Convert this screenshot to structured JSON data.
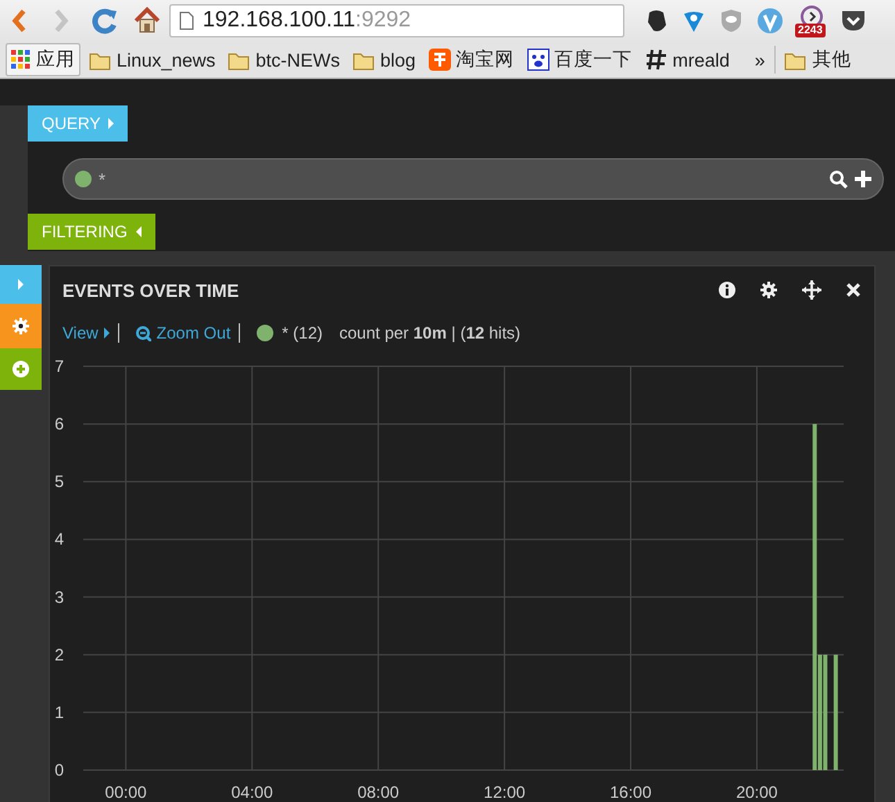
{
  "browser": {
    "address": {
      "host": "192.168.100.11",
      "port": ":9292"
    },
    "extension_badge": "2243",
    "bookmarks": [
      {
        "label": "应用",
        "kind": "apps"
      },
      {
        "label": "Linux_news",
        "kind": "folder"
      },
      {
        "label": "btc-NEWs",
        "kind": "folder"
      },
      {
        "label": "blog",
        "kind": "folder"
      },
      {
        "label": "淘宝网",
        "kind": "taobao"
      },
      {
        "label": "百度一下",
        "kind": "baidu"
      },
      {
        "label": "mreald",
        "kind": "hash"
      }
    ],
    "overflow": "»",
    "other_bookmarks": {
      "label": "其他",
      "kind": "folder"
    }
  },
  "query": {
    "label": "QUERY",
    "queries": [
      {
        "value": "*",
        "color": "#7eb26d"
      }
    ]
  },
  "filtering": {
    "label": "FILTERING"
  },
  "sidebar": {
    "buttons": [
      {
        "kind": "expand"
      },
      {
        "kind": "settings"
      },
      {
        "kind": "add"
      }
    ]
  },
  "panel": {
    "title": "EVENTS OVER TIME",
    "view": "View",
    "zoom_out": "Zoom Out",
    "legend": [
      {
        "label": "* (12)",
        "color": "#7eb26d"
      }
    ],
    "summary": "count per **10m** | (**12** hits)",
    "chart_data": {
      "type": "bar",
      "x": [
        21.833,
        22,
        22.167,
        22.5
      ],
      "series": [
        {
          "color": "#7eb26d",
          "values": [
            6,
            2,
            2,
            2
          ]
        }
      ],
      "grid": true,
      "xlim": [
        -1.35,
        22.75
      ],
      "ylim": [
        0,
        7
      ],
      "xticks": [
        {
          "value": 0,
          "label": "00:00"
        },
        {
          "value": 4,
          "label": "04:00"
        },
        {
          "value": 8,
          "label": "08:00"
        },
        {
          "value": 12,
          "label": "12:00"
        },
        {
          "value": 16,
          "label": "16:00"
        },
        {
          "value": 20,
          "label": "20:00"
        }
      ],
      "yticks": [
        0,
        1,
        2,
        3,
        4,
        5,
        6,
        7
      ]
    }
  }
}
